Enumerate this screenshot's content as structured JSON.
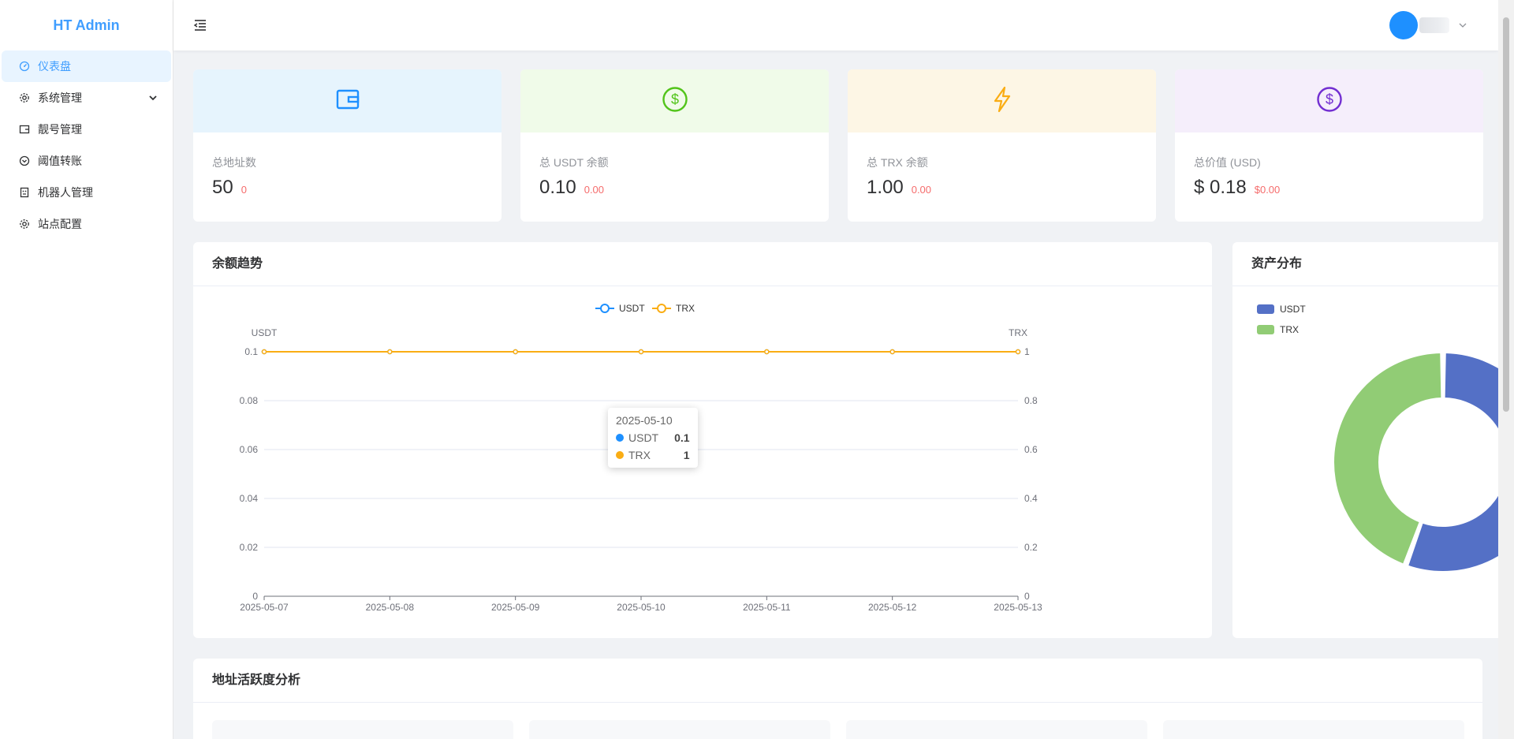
{
  "app": {
    "title": "HT Admin"
  },
  "sidebar": {
    "items": [
      {
        "label": "仪表盘",
        "icon": "dashboard-icon",
        "active": true
      },
      {
        "label": "系统管理",
        "icon": "gear-icon",
        "has_children": true
      },
      {
        "label": "靓号管理",
        "icon": "wallet-icon"
      },
      {
        "label": "阈值转账",
        "icon": "transfer-icon"
      },
      {
        "label": "机器人管理",
        "icon": "robot-icon"
      },
      {
        "label": "站点配置",
        "icon": "gear-icon"
      }
    ]
  },
  "header": {
    "menu_toggle_icon": "menu-fold-icon",
    "user_dropdown_icon": "chevron-down-icon"
  },
  "stats": [
    {
      "label": "总地址数",
      "value": "50",
      "delta": "0",
      "icon": "wallet-icon",
      "color": "#1e90ff",
      "bg": "#e6f4fd"
    },
    {
      "label": "总 USDT 余额",
      "value": "0.10",
      "delta": "0.00",
      "icon": "dollar-circle-icon",
      "color": "#52c41a",
      "bg": "#f0fbe9"
    },
    {
      "label": "总 TRX 余额",
      "value": "1.00",
      "delta": "0.00",
      "icon": "lightning-icon",
      "color": "#faad14",
      "bg": "#fdf6e5"
    },
    {
      "label": "总价值 (USD)",
      "value": "$ 0.18",
      "delta": "$0.00",
      "icon": "dollar-circle-icon",
      "color": "#722ed1",
      "bg": "#f5eefb"
    }
  ],
  "trend_panel": {
    "title": "余额趋势"
  },
  "distribution_panel": {
    "title": "资产分布"
  },
  "activity_panel": {
    "title": "地址活跃度分析"
  },
  "tooltip": {
    "date": "2025-05-10",
    "rows": [
      {
        "name": "USDT",
        "value": "0.1",
        "color": "#1e90ff"
      },
      {
        "name": "TRX",
        "value": "1",
        "color": "#faad14"
      }
    ]
  },
  "chart_data": [
    {
      "type": "line",
      "x": [
        "2025-05-07",
        "2025-05-08",
        "2025-05-09",
        "2025-05-10",
        "2025-05-11",
        "2025-05-12",
        "2025-05-13"
      ],
      "series": [
        {
          "name": "USDT",
          "axis": "left",
          "color": "#1e90ff",
          "values": [
            0.1,
            0.1,
            0.1,
            0.1,
            0.1,
            0.1,
            0.1
          ]
        },
        {
          "name": "TRX",
          "axis": "right",
          "color": "#faad14",
          "values": [
            1,
            1,
            1,
            1,
            1,
            1,
            1
          ]
        }
      ],
      "y_left": {
        "label": "USDT",
        "ticks": [
          "0",
          "0.02",
          "0.04",
          "0.06",
          "0.08",
          "0.1"
        ],
        "range": [
          0,
          0.1
        ]
      },
      "y_right": {
        "label": "TRX",
        "ticks": [
          "0",
          "0.2",
          "0.4",
          "0.6",
          "0.8",
          "1"
        ],
        "range": [
          0,
          1
        ]
      },
      "legend": [
        "USDT",
        "TRX"
      ],
      "legend_position": "top-center",
      "grid": true
    },
    {
      "type": "pie",
      "donut": true,
      "slices": [
        {
          "name": "USDT",
          "value": 0.1,
          "color": "#5470c6"
        },
        {
          "name": "TRX",
          "value": 0.08,
          "color": "#91cc75"
        }
      ],
      "legend_position": "top-left"
    }
  ]
}
